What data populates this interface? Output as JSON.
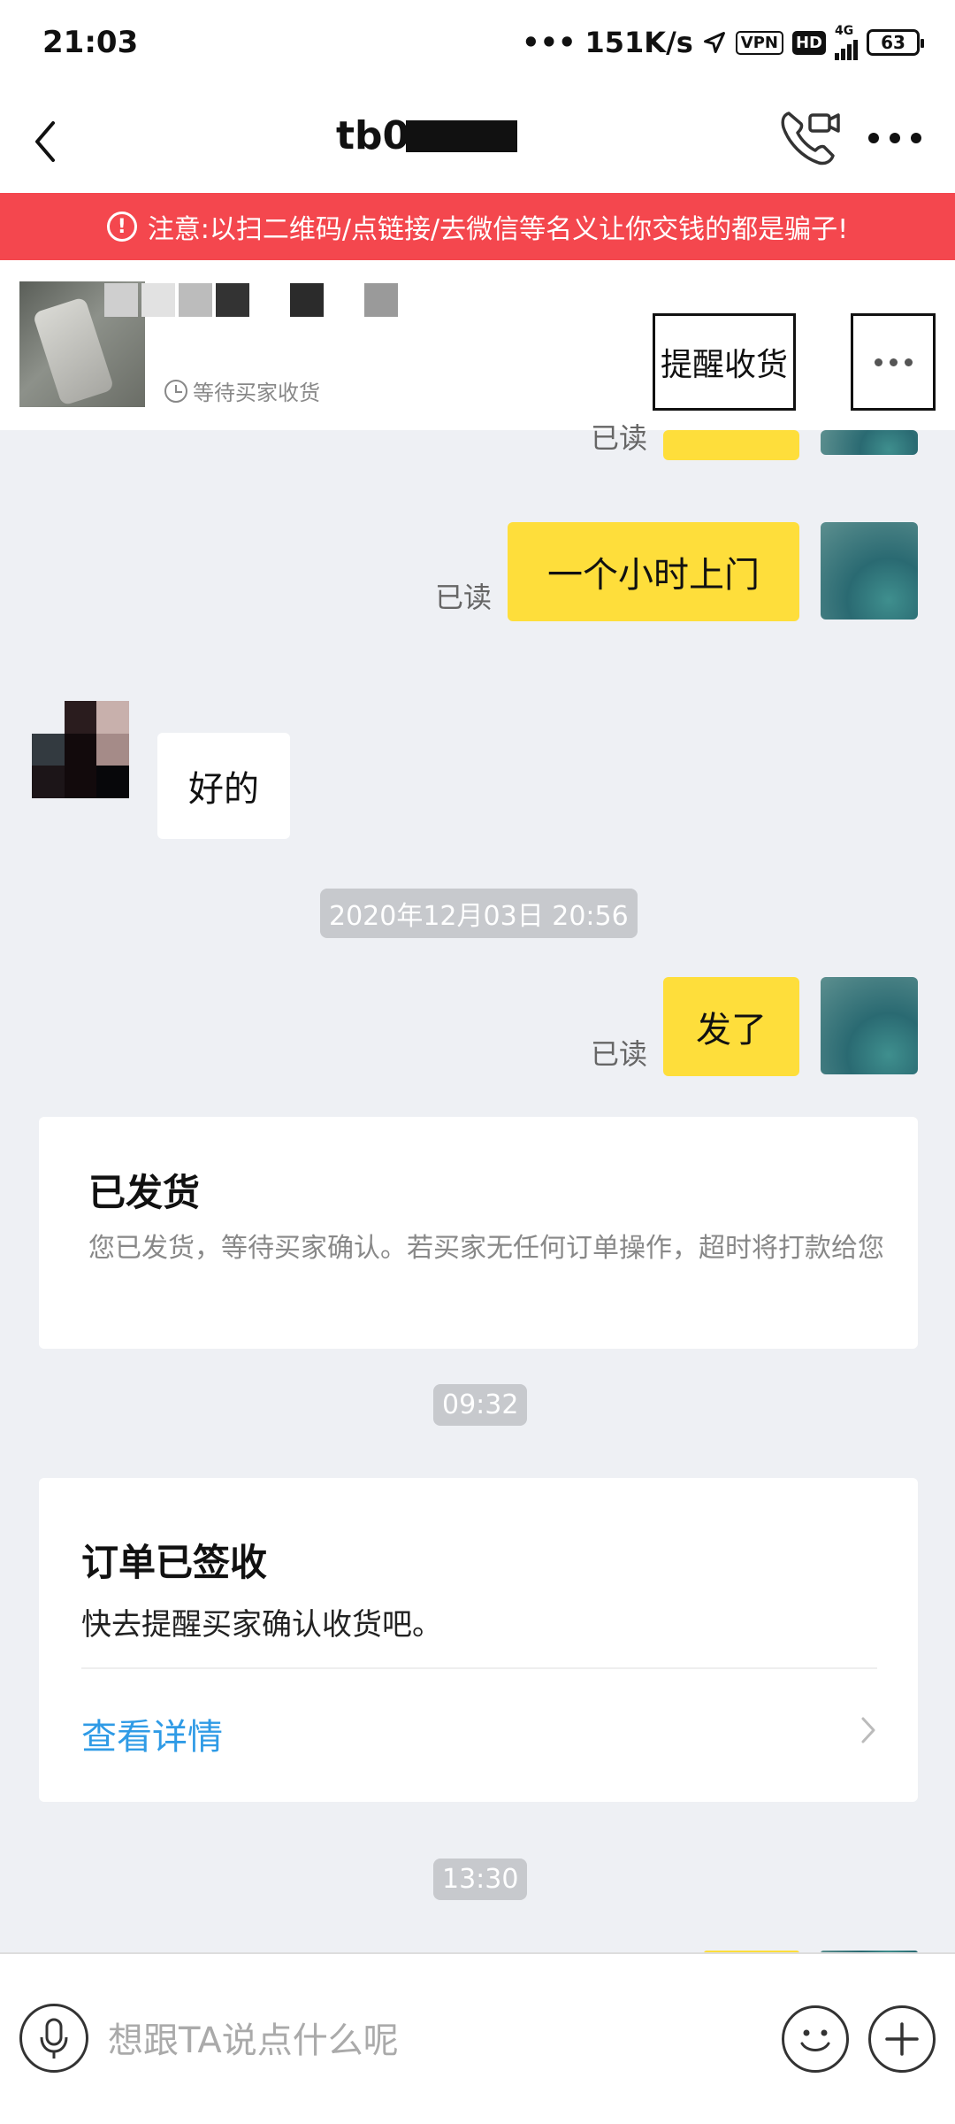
{
  "status_bar": {
    "time": "21:03",
    "speed": "151K/s",
    "vpn": "VPN",
    "hd": "HD",
    "network": "4G",
    "battery": "63"
  },
  "header": {
    "title": "tb0",
    "back_icon": "chevron-left-icon",
    "call_icon": "phone-video-icon",
    "more_icon": "more-horizontal-icon"
  },
  "warning": {
    "text": "注意:以扫二维码/点链接/去微信等名义让你交钱的都是骗子!",
    "icon": "exclamation-circle-icon"
  },
  "product": {
    "status": "等待买家收货",
    "remind_button": "提醒收货"
  },
  "messages": {
    "m1_read": "已读",
    "m2_read": "已读",
    "m2_text": "一个小时上门",
    "m3_text": "好的",
    "ts1": "2020年12月03日 20:56",
    "m4_read": "已读",
    "m4_text": "发了",
    "card1_title": "已发货",
    "card1_desc": "您已发货，等待买家确认。若买家无任何订单操作，超时将打款给您",
    "ts2": "09:32",
    "card2_title": "订单已签收",
    "card2_sub": "快去提醒买家确认收货吧。",
    "card2_link": "查看详情",
    "ts3": "13:30"
  },
  "input": {
    "placeholder": "想跟TA说点什么呢"
  },
  "colors": {
    "warning_bg": "#f4474e",
    "bubble_me": "#fede3b",
    "link": "#2f9be6",
    "page_bg": "#eef0f4"
  }
}
